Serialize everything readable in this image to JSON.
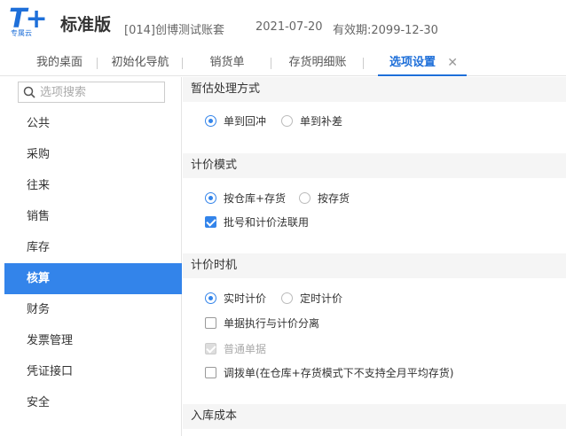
{
  "header": {
    "logo_text": "T+",
    "logo_sub": "专属云",
    "edition": "标准版",
    "account": "[014]创博测试账套",
    "date": "2021-07-20",
    "expire": "有效期:2099-12-30"
  },
  "tabs": [
    {
      "label": "我的桌面"
    },
    {
      "label": "初始化导航"
    },
    {
      "label": "销货单"
    },
    {
      "label": "存货明细账"
    },
    {
      "label": "选项设置",
      "close": "✕"
    }
  ],
  "sidebar": {
    "search_placeholder": "选项搜索",
    "items": [
      {
        "label": "公共"
      },
      {
        "label": "采购"
      },
      {
        "label": "往来"
      },
      {
        "label": "销售"
      },
      {
        "label": "库存"
      },
      {
        "label": "核算"
      },
      {
        "label": "财务"
      },
      {
        "label": "发票管理"
      },
      {
        "label": "凭证接口"
      },
      {
        "label": "安全"
      }
    ],
    "active_index": 5
  },
  "content": {
    "sections": [
      {
        "title": "暂估处理方式",
        "options": [
          {
            "type": "radio",
            "label": "单到回冲",
            "checked": true
          },
          {
            "type": "radio",
            "label": "单到补差",
            "checked": false
          }
        ]
      },
      {
        "title": "计价模式",
        "options": [
          {
            "type": "radio",
            "label": "按仓库+存货",
            "checked": true
          },
          {
            "type": "radio",
            "label": "按存货",
            "checked": false
          },
          {
            "type": "checkbox",
            "label": "批号和计价法联用",
            "checked": true
          }
        ]
      },
      {
        "title": "计价时机",
        "options": [
          {
            "type": "radio",
            "label": "实时计价",
            "checked": true
          },
          {
            "type": "radio",
            "label": "定时计价",
            "checked": false
          },
          {
            "type": "checkbox",
            "label": "单据执行与计价分离",
            "checked": false
          },
          {
            "type": "checkbox",
            "label": "普通单据",
            "checked": true,
            "disabled": true
          },
          {
            "type": "checkbox",
            "label": "调拨单(在仓库+存货模式下不支持全月平均存货)",
            "checked": false
          }
        ]
      },
      {
        "title": "入库成本",
        "options": []
      }
    ]
  },
  "colors": {
    "accent": "#3384ea",
    "brand": "#1e6fd9",
    "section_bg": "#f5f5f5"
  }
}
